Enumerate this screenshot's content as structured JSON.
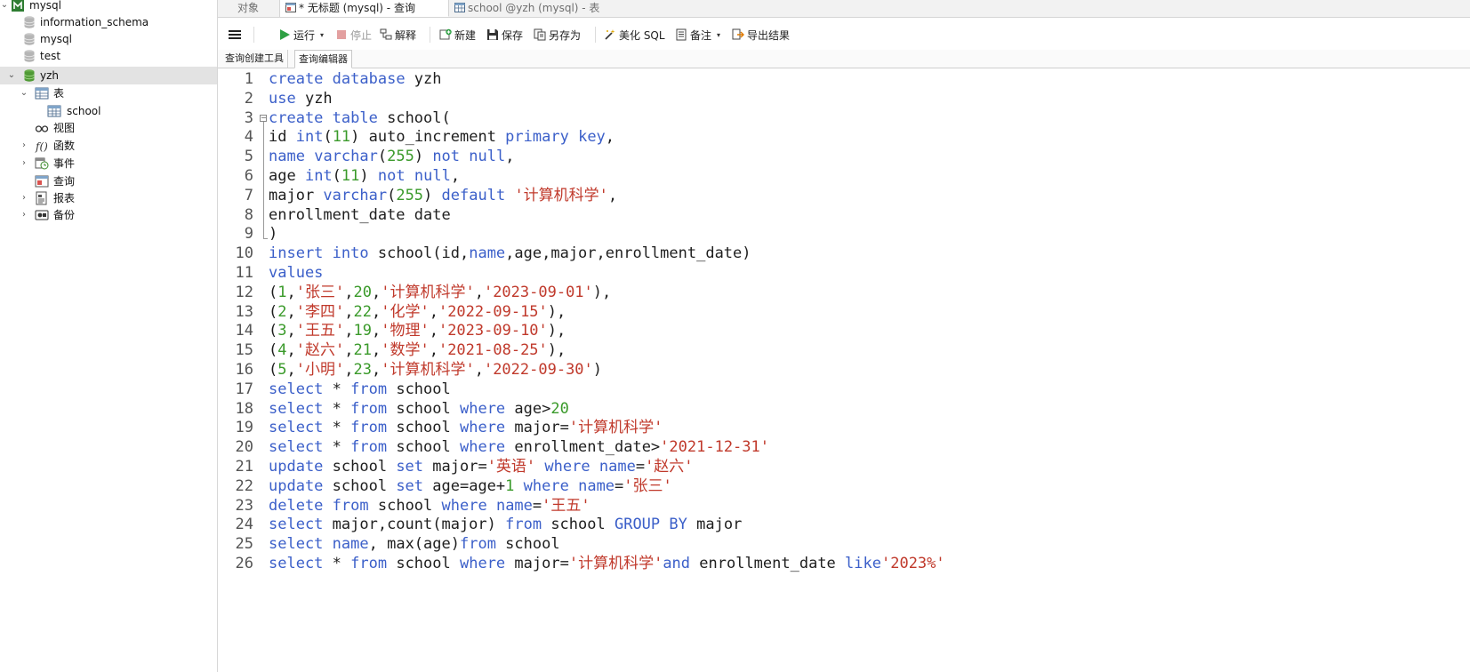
{
  "sidebar": {
    "connection": "mysql",
    "databases": [
      "information_schema",
      "mysql",
      "test",
      "yzh"
    ],
    "selected_database": "yzh",
    "children": [
      {
        "label": "表",
        "icon": "table-folder-icon",
        "expanded": true
      },
      {
        "label": "school",
        "icon": "table-icon"
      },
      {
        "label": "视图",
        "icon": "view-icon"
      },
      {
        "label": "函数",
        "icon": "function-icon"
      },
      {
        "label": "事件",
        "icon": "event-icon"
      },
      {
        "label": "查询",
        "icon": "query-icon"
      },
      {
        "label": "报表",
        "icon": "report-icon"
      },
      {
        "label": "备份",
        "icon": "backup-icon"
      }
    ]
  },
  "tabs": [
    {
      "label": "对象",
      "active": false
    },
    {
      "label": "* 无标题 (mysql) - 查询",
      "active": true,
      "icon": "query-tab-icon"
    },
    {
      "label": "school @yzh (mysql) - 表",
      "active": false,
      "icon": "table-tab-icon"
    }
  ],
  "toolbar": {
    "menu_icon": "hamburger-icon",
    "run": "运行",
    "stop": "停止",
    "explain": "解释",
    "new": "新建",
    "save": "保存",
    "save_as": "另存为",
    "beautify": "美化 SQL",
    "note": "备注",
    "export": "导出结果"
  },
  "subtabs": [
    {
      "label": "查询创建工具",
      "active": false
    },
    {
      "label": "查询编辑器",
      "active": true
    }
  ],
  "colors": {
    "keyword": "#3b5fc9",
    "number": "#3a9a2a",
    "string": "#c0392b",
    "plain": "#1e1e1e"
  },
  "editor": {
    "lines": [
      [
        [
          "k",
          "create"
        ],
        [
          "p",
          " "
        ],
        [
          "k",
          "database"
        ],
        [
          "p",
          " yzh"
        ]
      ],
      [
        [
          "k",
          "use"
        ],
        [
          "p",
          " yzh"
        ]
      ],
      [
        [
          "k",
          "create"
        ],
        [
          "p",
          " "
        ],
        [
          "k",
          "table"
        ],
        [
          "p",
          " school("
        ]
      ],
      [
        [
          "p",
          "id "
        ],
        [
          "k",
          "int"
        ],
        [
          "p",
          "("
        ],
        [
          "n",
          "11"
        ],
        [
          "p",
          ") auto_increment "
        ],
        [
          "k",
          "primary"
        ],
        [
          "p",
          " "
        ],
        [
          "k",
          "key"
        ],
        [
          "p",
          ","
        ]
      ],
      [
        [
          "k",
          "name"
        ],
        [
          "p",
          " "
        ],
        [
          "k",
          "varchar"
        ],
        [
          "p",
          "("
        ],
        [
          "n",
          "255"
        ],
        [
          "p",
          ") "
        ],
        [
          "k",
          "not"
        ],
        [
          "p",
          " "
        ],
        [
          "k",
          "null"
        ],
        [
          "p",
          ","
        ]
      ],
      [
        [
          "p",
          "age "
        ],
        [
          "k",
          "int"
        ],
        [
          "p",
          "("
        ],
        [
          "n",
          "11"
        ],
        [
          "p",
          ") "
        ],
        [
          "k",
          "not"
        ],
        [
          "p",
          " "
        ],
        [
          "k",
          "null"
        ],
        [
          "p",
          ","
        ]
      ],
      [
        [
          "p",
          "major "
        ],
        [
          "k",
          "varchar"
        ],
        [
          "p",
          "("
        ],
        [
          "n",
          "255"
        ],
        [
          "p",
          ") "
        ],
        [
          "k",
          "default"
        ],
        [
          "p",
          " "
        ],
        [
          "s",
          "'计算机科学'"
        ],
        [
          "p",
          ","
        ]
      ],
      [
        [
          "p",
          "enrollment_date date"
        ]
      ],
      [
        [
          "p",
          ")"
        ]
      ],
      [
        [
          "k",
          "insert"
        ],
        [
          "p",
          " "
        ],
        [
          "k",
          "into"
        ],
        [
          "p",
          " school(id,"
        ],
        [
          "k",
          "name"
        ],
        [
          "p",
          ",age,major,enrollment_date)"
        ]
      ],
      [
        [
          "k",
          "values"
        ]
      ],
      [
        [
          "p",
          "("
        ],
        [
          "n",
          "1"
        ],
        [
          "p",
          ","
        ],
        [
          "s",
          "'张三'"
        ],
        [
          "p",
          ","
        ],
        [
          "n",
          "20"
        ],
        [
          "p",
          ","
        ],
        [
          "s",
          "'计算机科学'"
        ],
        [
          "p",
          ","
        ],
        [
          "s",
          "'2023-09-01'"
        ],
        [
          "p",
          "),"
        ]
      ],
      [
        [
          "p",
          "("
        ],
        [
          "n",
          "2"
        ],
        [
          "p",
          ","
        ],
        [
          "s",
          "'李四'"
        ],
        [
          "p",
          ","
        ],
        [
          "n",
          "22"
        ],
        [
          "p",
          ","
        ],
        [
          "s",
          "'化学'"
        ],
        [
          "p",
          ","
        ],
        [
          "s",
          "'2022-09-15'"
        ],
        [
          "p",
          "),"
        ]
      ],
      [
        [
          "p",
          "("
        ],
        [
          "n",
          "3"
        ],
        [
          "p",
          ","
        ],
        [
          "s",
          "'王五'"
        ],
        [
          "p",
          ","
        ],
        [
          "n",
          "19"
        ],
        [
          "p",
          ","
        ],
        [
          "s",
          "'物理'"
        ],
        [
          "p",
          ","
        ],
        [
          "s",
          "'2023-09-10'"
        ],
        [
          "p",
          "),"
        ]
      ],
      [
        [
          "p",
          "("
        ],
        [
          "n",
          "4"
        ],
        [
          "p",
          ","
        ],
        [
          "s",
          "'赵六'"
        ],
        [
          "p",
          ","
        ],
        [
          "n",
          "21"
        ],
        [
          "p",
          ","
        ],
        [
          "s",
          "'数学'"
        ],
        [
          "p",
          ","
        ],
        [
          "s",
          "'2021-08-25'"
        ],
        [
          "p",
          "),"
        ]
      ],
      [
        [
          "p",
          "("
        ],
        [
          "n",
          "5"
        ],
        [
          "p",
          ","
        ],
        [
          "s",
          "'小明'"
        ],
        [
          "p",
          ","
        ],
        [
          "n",
          "23"
        ],
        [
          "p",
          ","
        ],
        [
          "s",
          "'计算机科学'"
        ],
        [
          "p",
          ","
        ],
        [
          "s",
          "'2022-09-30'"
        ],
        [
          "p",
          ")"
        ]
      ],
      [
        [
          "k",
          "select"
        ],
        [
          "p",
          " * "
        ],
        [
          "k",
          "from"
        ],
        [
          "p",
          " school"
        ]
      ],
      [
        [
          "k",
          "select"
        ],
        [
          "p",
          " * "
        ],
        [
          "k",
          "from"
        ],
        [
          "p",
          " school "
        ],
        [
          "k",
          "where"
        ],
        [
          "p",
          " age>"
        ],
        [
          "n",
          "20"
        ]
      ],
      [
        [
          "k",
          "select"
        ],
        [
          "p",
          " * "
        ],
        [
          "k",
          "from"
        ],
        [
          "p",
          " school "
        ],
        [
          "k",
          "where"
        ],
        [
          "p",
          " major="
        ],
        [
          "s",
          "'计算机科学'"
        ]
      ],
      [
        [
          "k",
          "select"
        ],
        [
          "p",
          " * "
        ],
        [
          "k",
          "from"
        ],
        [
          "p",
          " school "
        ],
        [
          "k",
          "where"
        ],
        [
          "p",
          " enrollment_date>"
        ],
        [
          "s",
          "'2021-12-31'"
        ]
      ],
      [
        [
          "k",
          "update"
        ],
        [
          "p",
          " school "
        ],
        [
          "k",
          "set"
        ],
        [
          "p",
          " major="
        ],
        [
          "s",
          "'英语'"
        ],
        [
          "p",
          " "
        ],
        [
          "k",
          "where"
        ],
        [
          "p",
          " "
        ],
        [
          "k",
          "name"
        ],
        [
          "p",
          "="
        ],
        [
          "s",
          "'赵六'"
        ]
      ],
      [
        [
          "k",
          "update"
        ],
        [
          "p",
          " school "
        ],
        [
          "k",
          "set"
        ],
        [
          "p",
          " age=age+"
        ],
        [
          "n",
          "1"
        ],
        [
          "p",
          " "
        ],
        [
          "k",
          "where"
        ],
        [
          "p",
          " "
        ],
        [
          "k",
          "name"
        ],
        [
          "p",
          "="
        ],
        [
          "s",
          "'张三'"
        ]
      ],
      [
        [
          "k",
          "delete"
        ],
        [
          "p",
          " "
        ],
        [
          "k",
          "from"
        ],
        [
          "p",
          " school "
        ],
        [
          "k",
          "where"
        ],
        [
          "p",
          " "
        ],
        [
          "k",
          "name"
        ],
        [
          "p",
          "="
        ],
        [
          "s",
          "'王五'"
        ]
      ],
      [
        [
          "k",
          "select"
        ],
        [
          "p",
          " major,count(major) "
        ],
        [
          "k",
          "from"
        ],
        [
          "p",
          " school "
        ],
        [
          "k",
          "GROUP"
        ],
        [
          "p",
          " "
        ],
        [
          "k",
          "BY"
        ],
        [
          "p",
          " major"
        ]
      ],
      [
        [
          "k",
          "select"
        ],
        [
          "p",
          " "
        ],
        [
          "k",
          "name"
        ],
        [
          "p",
          ", max(age)"
        ],
        [
          "k",
          "from"
        ],
        [
          "p",
          " school"
        ]
      ],
      [
        [
          "k",
          "select"
        ],
        [
          "p",
          " * "
        ],
        [
          "k",
          "from"
        ],
        [
          "p",
          " school "
        ],
        [
          "k",
          "where"
        ],
        [
          "p",
          " major="
        ],
        [
          "s",
          "'计算机科学'"
        ],
        [
          "k",
          "and"
        ],
        [
          "p",
          " enrollment_date "
        ],
        [
          "k",
          "like"
        ],
        [
          "s",
          "'2023%'"
        ]
      ]
    ]
  }
}
